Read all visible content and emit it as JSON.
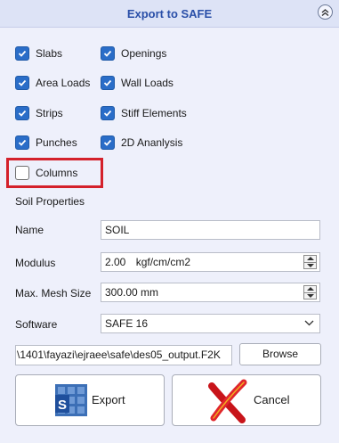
{
  "window": {
    "title": "Export to SAFE"
  },
  "options": [
    {
      "label": "Slabs",
      "checked": true
    },
    {
      "label": "Openings",
      "checked": true
    },
    {
      "label": "Area Loads",
      "checked": true
    },
    {
      "label": "Wall Loads",
      "checked": true
    },
    {
      "label": "Strips",
      "checked": true
    },
    {
      "label": "Stiff Elements",
      "checked": true
    },
    {
      "label": "Punches",
      "checked": true
    },
    {
      "label": "2D Ananlysis",
      "checked": true
    },
    {
      "label": "Columns",
      "checked": false
    }
  ],
  "soil": {
    "section_label": "Soil Properties",
    "name_label": "Name",
    "name_value": "SOIL",
    "modulus_label": "Modulus",
    "modulus_value": "2.00",
    "modulus_unit": "kgf/cm/cm2",
    "mesh_label": "Max. Mesh Size",
    "mesh_value": "300.00 mm"
  },
  "software": {
    "label": "Software",
    "selected": "SAFE 16"
  },
  "output": {
    "path": "\\1401\\fayazi\\ejraee\\safe\\des05_output.F2K",
    "browse_label": "Browse"
  },
  "actions": {
    "export_label": "Export",
    "cancel_label": "Cancel"
  },
  "colors": {
    "accent": "#2a6dc8",
    "title": "#2a4fa8",
    "highlight": "#d4212b",
    "background": "#eef0fb"
  }
}
